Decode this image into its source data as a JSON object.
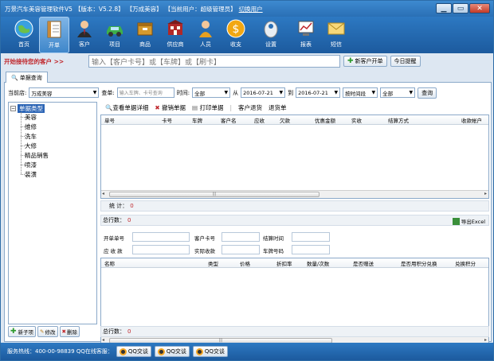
{
  "titlebar": {
    "app": "万景汽车美容管理软件V5",
    "version": "【版本：V5.2.8】",
    "store": "【万成美容】",
    "user": "【当前用户：超级管理员】",
    "switch_user": "切换用户"
  },
  "toolbar": {
    "items": [
      {
        "label": "首页",
        "icon": "globe-icon"
      },
      {
        "label": "开单",
        "icon": "document-icon"
      },
      {
        "label": "客户",
        "icon": "customer-icon"
      },
      {
        "label": "项目",
        "icon": "car-icon"
      },
      {
        "label": "商品",
        "icon": "goods-icon"
      },
      {
        "label": "供应商",
        "icon": "supplier-icon"
      },
      {
        "label": "人员",
        "icon": "person-icon"
      },
      {
        "label": "收支",
        "icon": "coin-icon"
      },
      {
        "label": "设置",
        "icon": "settings-icon"
      },
      {
        "label": "报表",
        "icon": "report-icon"
      },
      {
        "label": "短信",
        "icon": "mail-icon"
      }
    ]
  },
  "customer_bar": {
    "label": "开始接待您的客户 >>",
    "placeholder": "输入【客户卡号】或【车牌】或【刷卡】",
    "new_customer": "新客户开单",
    "today_reminder": "今日提醒"
  },
  "tab": {
    "label": "单据查询"
  },
  "filter": {
    "store_label": "当前店:",
    "store_value": "万成美容",
    "doc_label": "查单:",
    "doc_placeholder": "输入车牌、卡号查询",
    "time_label": "时间:",
    "time_value": "全部",
    "from_label": "从",
    "from_date": "2016-07-21",
    "to_label": "到",
    "to_date": "2016-07-21",
    "period_value": "按时间段",
    "all_value": "全部",
    "query_btn": "查询"
  },
  "tree": {
    "root": "单据类型",
    "items": [
      "美容",
      "维修",
      "洗车",
      "大修",
      "精品销售",
      "喷漆",
      "装潢"
    ]
  },
  "tree_buttons": {
    "add": "新子项",
    "edit": "修改",
    "delete": "删除"
  },
  "actions": {
    "view": "查看单据详细",
    "revoke": "撤销单据",
    "print": "打印单据",
    "refund": "客户退货",
    "return": "退货单"
  },
  "grid_columns": [
    "单号",
    "卡号",
    "车牌",
    "客户名",
    "应收",
    "欠款",
    "优惠金额",
    "实收",
    "结算方式",
    "收款帐户"
  ],
  "summary": {
    "stat_label": "统 计：",
    "stat_value": "0",
    "total_label": "总行数：",
    "total_value": "0",
    "export": "导出Excel"
  },
  "form": {
    "order_no": "开单单号",
    "card_no": "客户卡号",
    "settle_time": "结算时间",
    "receivable": "应 收 款",
    "actual": "实际收款",
    "plate": "车牌号码"
  },
  "detail_columns": [
    "名称",
    "类型",
    "价格",
    "折扣率",
    "数量/次数",
    "是否赠送",
    "是否用积分兑换",
    "兑换积分"
  ],
  "detail_summary": {
    "total_label": "总行数：",
    "total_value": "0"
  },
  "statusbar": {
    "hotline": "服务热线：400-00-98839 QQ在线客服：",
    "qq": [
      "QQ交谈",
      "QQ交谈",
      "QQ交谈"
    ]
  }
}
